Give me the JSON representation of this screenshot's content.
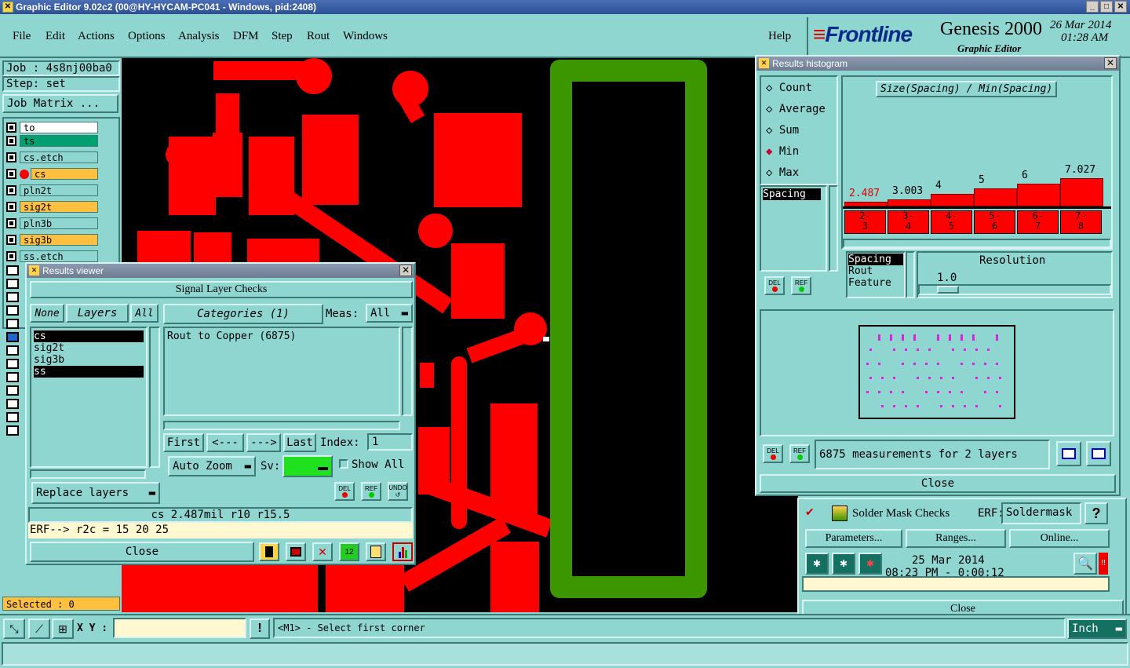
{
  "window": {
    "title": "Graphic Editor 9.02c2 (00@HY-HYCAM-PC041 - Windows, pid:2408)"
  },
  "menu": [
    "File",
    "Edit",
    "Actions",
    "Options",
    "Analysis",
    "DFM",
    "Step",
    "Rout",
    "Windows"
  ],
  "help": "Help",
  "brand": {
    "logo": "Frontline",
    "product": "Genesis 2000",
    "sub": "Graphic Editor",
    "date": "26 Mar 2014",
    "time": "01:28 AM"
  },
  "job": {
    "job_label": "Job : 4s8nj00ba0",
    "step_label": "Step: set",
    "matrix_button": "Job Matrix ..."
  },
  "layers": [
    {
      "name": "to",
      "color": "#ffffff"
    },
    {
      "name": "ts",
      "color": "#00a070"
    },
    {
      "name": "cs.etch",
      "color": "#8fd5d0"
    },
    {
      "name": "cs",
      "color": "#ffc040"
    },
    {
      "name": "pln2t",
      "color": "#8fd5d0"
    },
    {
      "name": "sig2t",
      "color": "#ffc040"
    },
    {
      "name": "pln3b",
      "color": "#8fd5d0"
    },
    {
      "name": "sig3b",
      "color": "#ffc040"
    },
    {
      "name": "ss.etch",
      "color": "#8fd5d0"
    }
  ],
  "selected": "Selected : 0",
  "results_viewer": {
    "title": "Results viewer",
    "heading": "Signal Layer Checks",
    "none_btn": "None",
    "layers_btn": "Layers",
    "all_btn": "All",
    "categories_btn": "Categories (1)",
    "meas_label": "Meas:",
    "meas_value": "All",
    "layer_list": [
      "cs",
      "sig2t",
      "sig3b",
      "ss"
    ],
    "category_list": [
      "Rout to Copper (6875)"
    ],
    "first": "First",
    "prev": "<---",
    "next": "--->",
    "last": "Last",
    "index_label": "Index:",
    "index_value": "1",
    "auto_zoom": "Auto Zoom",
    "sv_label": "Sv:",
    "show_all": "Show All",
    "replace_layers": "Replace layers",
    "del": "DEL",
    "ref": "REF",
    "undo": "UNDO",
    "status": "cs 2.487mil   r10   r15.5",
    "erf": "ERF--> r2c = 15 20 25",
    "close": "Close"
  },
  "histogram": {
    "title": "Results histogram",
    "modes": [
      "Count",
      "Average",
      "Sum",
      "Min",
      "Max"
    ],
    "selected_mode": "Min",
    "chart_title": "Size(Spacing) / Min(Spacing)",
    "list_item": "Spacing",
    "bar_values": [
      "2.487",
      "3.003",
      "4",
      "5",
      "6",
      "7.027"
    ],
    "bar_labels": [
      "2-3",
      "3-4",
      "4-5",
      "5-6",
      "6-7",
      "7-8"
    ],
    "bin_list": [
      "Spacing",
      "Rout",
      "Feature"
    ],
    "resolution_label": "Resolution",
    "resolution_value": "1.0",
    "summary": "6875 measurements for 2 layers",
    "close": "Close",
    "del": "DEL",
    "ref": "REF"
  },
  "solder": {
    "title": "Solder Mask Checks",
    "erf_label": "ERF:",
    "erf_value": "Soldermask",
    "help": "?",
    "parameters": "Parameters...",
    "ranges": "Ranges...",
    "online": "Online...",
    "date": "25 Mar 2014",
    "time": "08:23 PM - 0:00:12",
    "close": "Close"
  },
  "bottom": {
    "xy_label": "X Y :",
    "xy_value": "",
    "prompt": "<M1> - Select first corner",
    "units": "Inch"
  },
  "colors": {
    "copper": "#ff0000",
    "rout": "#3c9600",
    "bg": "#8fd5d0",
    "highlight": "#00e000"
  }
}
